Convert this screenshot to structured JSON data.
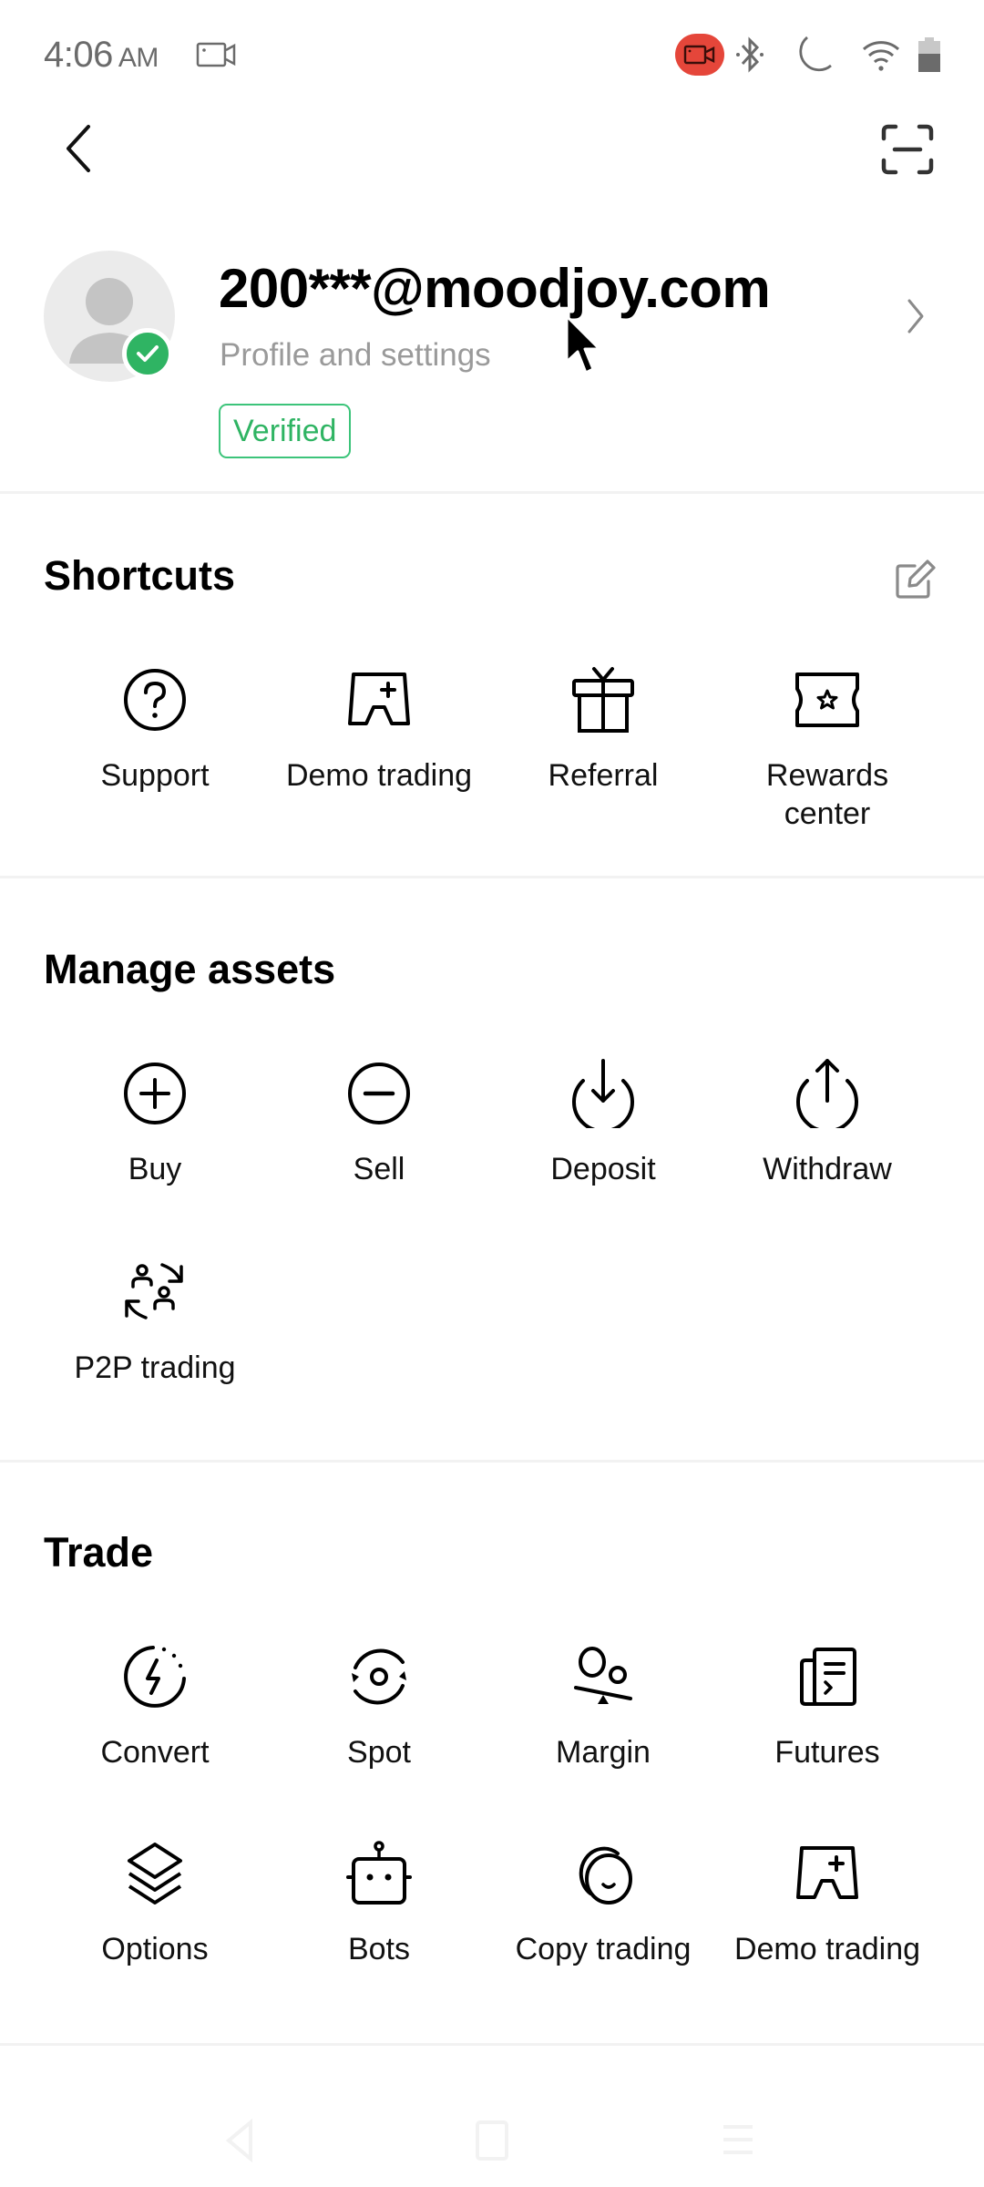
{
  "status_bar": {
    "time": "4:06",
    "ampm": "AM",
    "icons": [
      "screen-record-icon",
      "recording-active-icon",
      "bluetooth-icon",
      "do-not-disturb-moon-icon",
      "wifi-icon",
      "battery-icon"
    ],
    "record_badge_color": "#e5463a"
  },
  "header": {
    "back_icon": "chevron-left-icon",
    "scan_icon": "scan-icon"
  },
  "profile": {
    "email": "200***@moodjoy.com",
    "subtitle": "Profile and settings",
    "badge": "Verified",
    "verified_color": "#2fb463"
  },
  "shortcuts": {
    "title": "Shortcuts",
    "edit_icon": "edit-icon",
    "items": [
      {
        "label": "Support",
        "icon": "help-circle-icon"
      },
      {
        "label": "Demo trading",
        "icon": "demo-trading-icon"
      },
      {
        "label": "Referral",
        "icon": "gift-icon"
      },
      {
        "label": "Rewards center",
        "icon": "ticket-star-icon"
      }
    ]
  },
  "manage_assets": {
    "title": "Manage assets",
    "items": [
      {
        "label": "Buy",
        "icon": "plus-circle-icon"
      },
      {
        "label": "Sell",
        "icon": "minus-circle-icon"
      },
      {
        "label": "Deposit",
        "icon": "deposit-arrow-down-icon"
      },
      {
        "label": "Withdraw",
        "icon": "withdraw-arrow-up-icon"
      },
      {
        "label": "P2P trading",
        "icon": "p2p-users-exchange-icon"
      }
    ]
  },
  "trade": {
    "title": "Trade",
    "items": [
      {
        "label": "Convert",
        "icon": "convert-lightning-icon"
      },
      {
        "label": "Spot",
        "icon": "spot-refresh-icon"
      },
      {
        "label": "Margin",
        "icon": "margin-balance-icon"
      },
      {
        "label": "Futures",
        "icon": "futures-document-icon"
      },
      {
        "label": "Options",
        "icon": "layers-icon"
      },
      {
        "label": "Bots",
        "icon": "robot-icon"
      },
      {
        "label": "Copy trading",
        "icon": "copy-trading-icon"
      },
      {
        "label": "Demo trading",
        "icon": "demo-trading-icon"
      }
    ]
  },
  "nav_bar": {
    "back": "nav-back-icon",
    "home": "nav-home-icon",
    "recents": "nav-recents-icon"
  }
}
